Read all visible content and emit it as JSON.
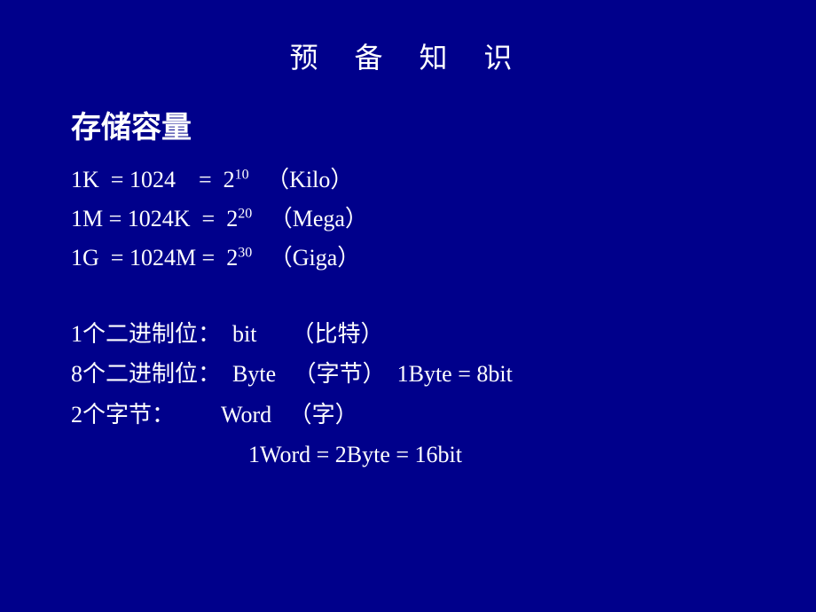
{
  "title": "预  备  知  识",
  "section": {
    "storage_title": "存储容量",
    "formulas": [
      {
        "text_left": "1K  = 1024",
        "equals": "=",
        "power_base": "2",
        "power_exp": "10",
        "label": "（Kilo）"
      },
      {
        "text_left": "1M = 1024K",
        "equals": "=",
        "power_base": "2",
        "power_exp": "20",
        "label": "（Mega）"
      },
      {
        "text_left": "1G  = 1024M =",
        "equals": "",
        "power_base": "2",
        "power_exp": "30",
        "label": "（Giga）"
      }
    ],
    "bits": [
      {
        "label": "1个二进制位：",
        "value": "bit",
        "note": "（比特）",
        "extra": ""
      },
      {
        "label": "8个二进制位：",
        "value": "Byte",
        "note": "（字节）",
        "extra": "1Byte = 8bit"
      },
      {
        "label": "2个字节：",
        "value": "Word",
        "note": "（字）",
        "extra": ""
      }
    ],
    "word_formula": "1Word = 2Byte = 16bit"
  }
}
